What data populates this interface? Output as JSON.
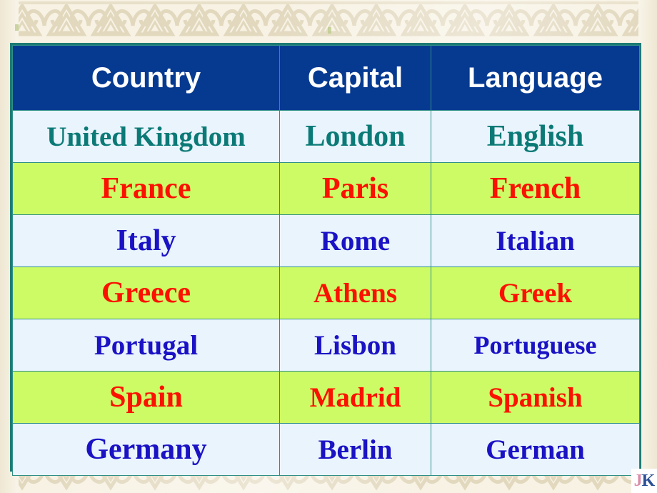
{
  "slide": {
    "background_color": "#f7f2e4",
    "pattern_name": "celtic-triangle-knot-border",
    "pattern_color": "#ddd2b6"
  },
  "table": {
    "border_color": "#1d7b74",
    "gridline_color": "#2f8f86",
    "header": {
      "background_color": "#063a91",
      "text_color": "#ffffff",
      "columns": [
        {
          "label": "Country"
        },
        {
          "label": "Capital"
        },
        {
          "label": "Language"
        }
      ]
    },
    "row_colors": {
      "pale_blue": "#e9f4fd",
      "lime_green": "#ccfb66"
    },
    "text_colors": {
      "teal": "#0b7a76",
      "red": "#fb1100",
      "blue": "#1a12c4"
    },
    "rows": [
      {
        "country": "United Kingdom",
        "capital": "London",
        "language": "English",
        "row_background": "pale_blue",
        "text_color": "teal"
      },
      {
        "country": "France",
        "capital": "Paris",
        "language": "French",
        "row_background": "lime_green",
        "text_color": "red"
      },
      {
        "country": "Italy",
        "capital": "Rome",
        "language": "Italian",
        "row_background": "pale_blue",
        "text_color": "blue"
      },
      {
        "country": "Greece",
        "capital": "Athens",
        "language": "Greek",
        "row_background": "lime_green",
        "text_color": "red"
      },
      {
        "country": "Portugal",
        "capital": "Lisbon",
        "language": "Portuguese",
        "row_background": "pale_blue",
        "text_color": "blue"
      },
      {
        "country": "Spain",
        "capital": "Madrid",
        "language": "Spanish",
        "row_background": "lime_green",
        "text_color": "red"
      },
      {
        "country": "Germany",
        "capital": "Berlin",
        "language": "German",
        "row_background": "pale_blue",
        "text_color": "blue"
      }
    ]
  },
  "watermark": {
    "letter_first": "J",
    "letter_second": "K",
    "color_first": "#d98ca8",
    "color_second": "#2b4f96"
  }
}
